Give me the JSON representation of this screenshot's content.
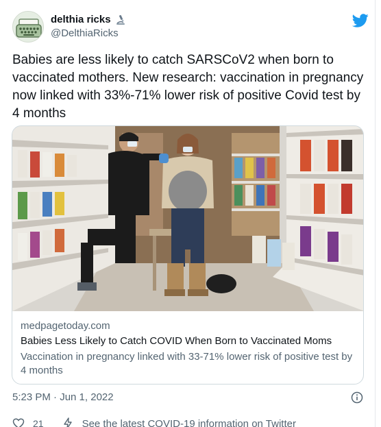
{
  "author": {
    "display_name": "delthia ricks",
    "handle": "@DelthiaRicks",
    "name_emoji_icon": "microscope-icon",
    "avatar_icon": "typewriter-icon"
  },
  "platform_icon": "twitter-bird-icon",
  "tweet": {
    "text": "Babies are less likely to catch SARSCoV2 when born to vaccinated mothers. New research: vaccination in pregnancy now linked with 33%-71% lower risk of positive Covid test by 4 months"
  },
  "link_card": {
    "domain": "medpagetoday.com",
    "title": "Babies Less Likely to Catch COVID When Born to Vaccinated Moms",
    "description": "Vaccination in pregnancy linked with 33-71% lower risk of positive test by 4 months"
  },
  "timestamp": "5:23 PM · Jun 1, 2022",
  "actions": {
    "like_count": "21",
    "covid_link": "See the latest COVID-19 information on Twitter"
  },
  "colors": {
    "brand": "#1d9bf0",
    "text_primary": "#0f1419",
    "text_secondary": "#536471",
    "border": "#cfd9de"
  }
}
